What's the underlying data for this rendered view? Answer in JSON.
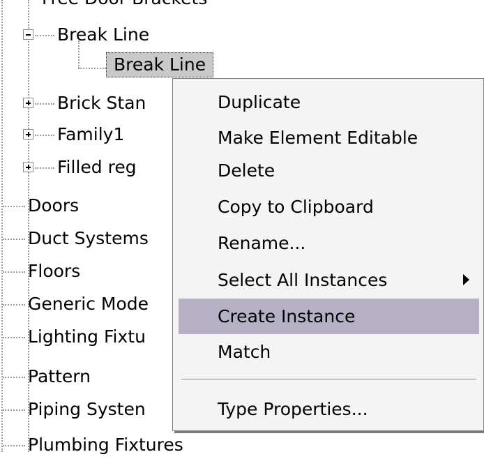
{
  "tree": {
    "cut_top_label": "Free Door Brackets",
    "break_line_parent": "Break Line",
    "break_line_child": "Break Line",
    "items_nested": [
      {
        "label": "Brick Stan"
      },
      {
        "label": "Family1"
      },
      {
        "label": "Filled reg"
      }
    ],
    "items_root": [
      {
        "label": "Doors"
      },
      {
        "label": "Duct Systems"
      },
      {
        "label": "Floors"
      },
      {
        "label": "Generic Mode"
      },
      {
        "label": "Lighting Fixtu"
      },
      {
        "label": "Pattern"
      },
      {
        "label": "Piping Systen"
      },
      {
        "label": "Plumbing Fixtures"
      }
    ]
  },
  "context_menu": {
    "items": [
      {
        "label": "Duplicate"
      },
      {
        "label": "Make Element Editable"
      },
      {
        "label": "Delete"
      },
      {
        "label": "Copy to Clipboard"
      },
      {
        "label": "Rename..."
      },
      {
        "label": "Select All Instances",
        "submenu": true
      },
      {
        "label": "Create Instance",
        "highlighted": true
      },
      {
        "label": "Match"
      },
      {
        "label": "Type Properties..."
      }
    ]
  },
  "colors": {
    "highlight": "#b6b0c4",
    "selection": "#c9c9c9",
    "menu_bg": "#f4f4f4"
  }
}
